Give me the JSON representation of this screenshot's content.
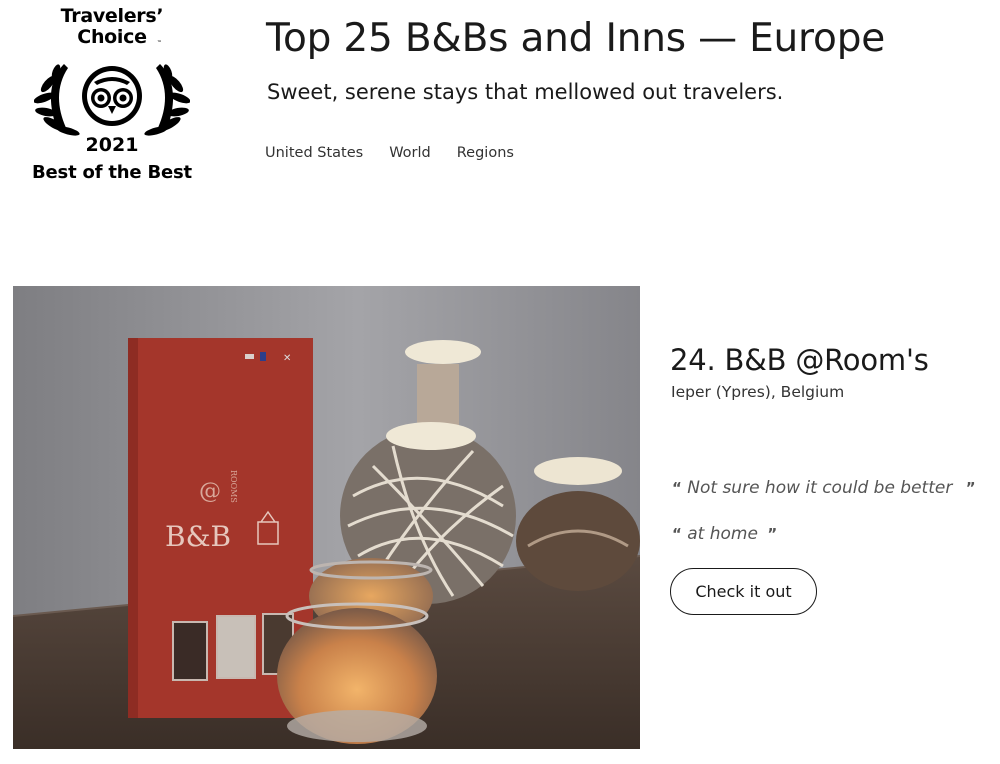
{
  "badge": {
    "line1": "Travelers’",
    "line2": "Choice",
    "year": "2021",
    "subtitle": "Best of the Best"
  },
  "header": {
    "title": "Top 25 B&Bs and Inns — Europe",
    "subtitle": "Sweet, serene stays that mellowed out travelers.",
    "tabs": [
      {
        "label": "United States"
      },
      {
        "label": "World"
      },
      {
        "label": "Regions"
      }
    ]
  },
  "listing": {
    "title": "24. B&B @Room's",
    "location": "Ieper (Ypres), Belgium",
    "quotes": [
      {
        "open": "“",
        "text": "Not sure how it could be better",
        "close": "”"
      },
      {
        "open": "“",
        "text": "at home",
        "close": "”"
      }
    ],
    "cta_label": "Check it out",
    "photo": {
      "sign_text": "B&B",
      "sign_brand": "@ ROOMS"
    }
  },
  "colors": {
    "text": "#1a1a1a",
    "sign_red": "#a4362b",
    "candle_glow": "#e8a25a",
    "wall": "#8c8c90",
    "table": "#4a3a30"
  },
  "icons": [
    "owl-icon",
    "laurel-left-icon",
    "laurel-right-icon",
    "flag-icon"
  ]
}
